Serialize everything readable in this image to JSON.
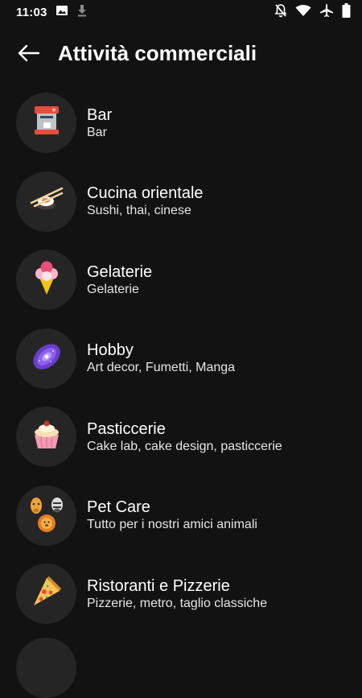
{
  "status": {
    "time": "11:03",
    "icons": [
      "image-icon",
      "download-icon",
      "notifications-off-icon",
      "wifi-icon",
      "airplane-icon",
      "battery-icon"
    ]
  },
  "header": {
    "title": "Attività commerciali",
    "back_icon": "arrow-back-icon"
  },
  "items": [
    {
      "name": "Bar",
      "subtitle": "Bar",
      "icon": "coffee-machine-icon"
    },
    {
      "name": "Cucina orientale",
      "subtitle": "Sushi, thai, cinese",
      "icon": "sushi-chopsticks-icon"
    },
    {
      "name": "Gelaterie",
      "subtitle": "Gelaterie",
      "icon": "ice-cream-cone-icon"
    },
    {
      "name": "Hobby",
      "subtitle": "Art decor, Fumetti, Manga",
      "icon": "galaxy-icon"
    },
    {
      "name": "Pasticcerie",
      "subtitle": "Cake lab, cake design, pasticcerie",
      "icon": "cupcake-icon"
    },
    {
      "name": "Pet Care",
      "subtitle": "Tutto per i nostri amici animali",
      "icon": "animals-icon"
    },
    {
      "name": "Ristoranti e Pizzerie",
      "subtitle": "Pizzerie, metro, taglio classiche",
      "icon": "pizza-slice-icon"
    }
  ]
}
